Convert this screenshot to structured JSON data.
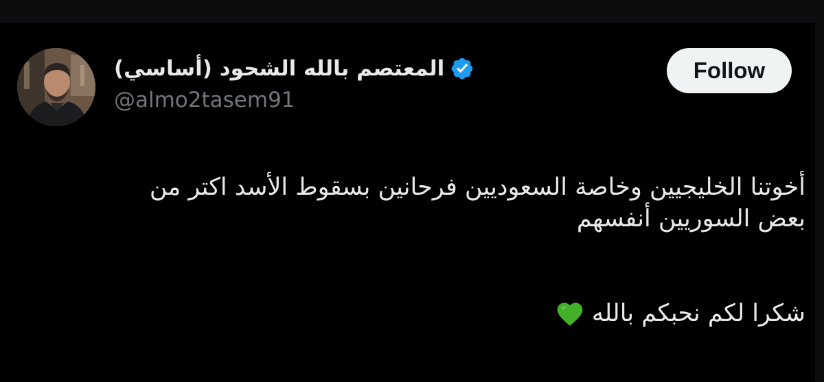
{
  "tweet": {
    "author": {
      "display_name": "المعتصم بالله الشحود (أساسي)",
      "handle": "@almo2tasem91",
      "verified_icon": "verified-badge-icon",
      "avatar": "profile-photo"
    },
    "follow_label": "Follow",
    "text_lines": [
      "أخوتنا الخليجيين وخاصة السعوديين فرحانين بسقوط الأسد اكتر من",
      "بعض السوريين أنفسهم",
      "شكرا لكم  نحبكم بالله"
    ],
    "emoji": "green-heart-icon"
  },
  "colors": {
    "background": "#000000",
    "text": "#e7e9ea",
    "secondary_text": "#71767b",
    "verified": "#1d9bf0",
    "follow_bg": "#eff3f4",
    "heart": "#43b02a"
  }
}
